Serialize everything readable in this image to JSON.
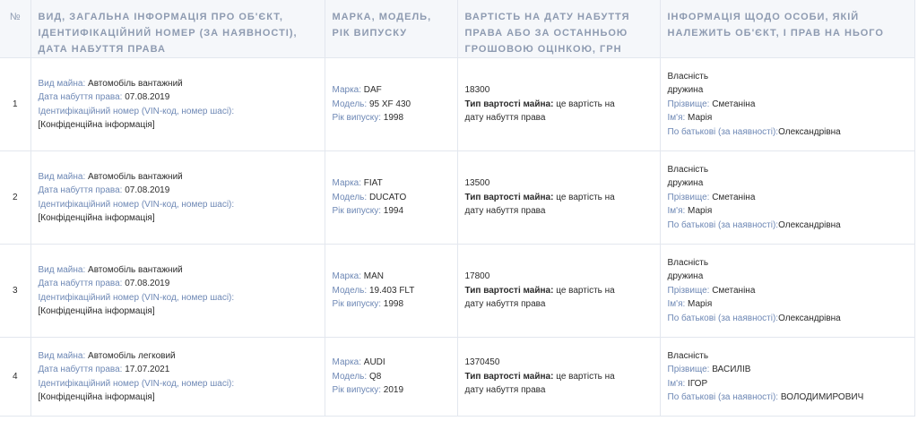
{
  "headers": {
    "num": "№",
    "general": "Вид, загальна інформація про об'єкт, ідентифікаційний номер (за наявності), дата набуття права",
    "brand": "Марка, модель, рік випуску",
    "value": "Вартість на дату набуття права або за останньою грошовою оцінкою, грн",
    "owner": "Інформація щодо особи, якій належить об'єкт, і прав на нього"
  },
  "labels": {
    "kind": "Вид майна:",
    "acq_date": "Дата набуття права:",
    "vin": "Ідентифікаційний номер (VIN-код, номер шасі):",
    "make": "Марка:",
    "model": "Модель:",
    "year": "Рік випуску:",
    "value_type": "Тип вартості майна:",
    "surname": "Прізвище:",
    "name": "Ім'я:",
    "patronymic": "По батькові (за наявності):"
  },
  "rows": [
    {
      "num": "1",
      "kind": "Автомобіль вантажний",
      "acq_date": "07.08.2019",
      "vin": "[Конфіденційна інформація]",
      "make": "DAF",
      "model": "95 XF 430",
      "year": "1998",
      "cost": "18300",
      "value_type_1": "це вартість на",
      "value_type_2": "дату набуття права",
      "right": "Власність",
      "relation": "дружина",
      "surname": "Сметаніна",
      "name": "Марія",
      "patronymic": "Олександрівна"
    },
    {
      "num": "2",
      "kind": "Автомобіль вантажний",
      "acq_date": "07.08.2019",
      "vin": "[Конфіденційна інформація]",
      "make": "FIAT",
      "model": "DUCATO",
      "year": "1994",
      "cost": "13500",
      "value_type_1": "це вартість на",
      "value_type_2": "дату набуття права",
      "right": "Власність",
      "relation": "дружина",
      "surname": "Сметаніна",
      "name": "Марія",
      "patronymic": "Олександрівна"
    },
    {
      "num": "3",
      "kind": "Автомобіль вантажний",
      "acq_date": "07.08.2019",
      "vin": "[Конфіденційна інформація]",
      "make": "MAN",
      "model": "19.403 FLT",
      "year": "1998",
      "cost": "17800",
      "value_type_1": "це вартість на",
      "value_type_2": "дату набуття права",
      "right": "Власність",
      "relation": "дружина",
      "surname": "Сметаніна",
      "name": "Марія",
      "patronymic": "Олександрівна"
    },
    {
      "num": "4",
      "kind": "Автомобіль легковий",
      "acq_date": "17.07.2021",
      "vin": "[Конфіденційна інформація]",
      "make": "AUDI",
      "model": "Q8",
      "year": "2019",
      "cost": "1370450",
      "value_type_1": "це вартість на",
      "value_type_2": "дату набуття права",
      "right": "Власність",
      "surname": "ВАСИЛІВ",
      "name": "ІГОР",
      "patronymic": "ВОЛОДИМИРОВИЧ"
    }
  ]
}
